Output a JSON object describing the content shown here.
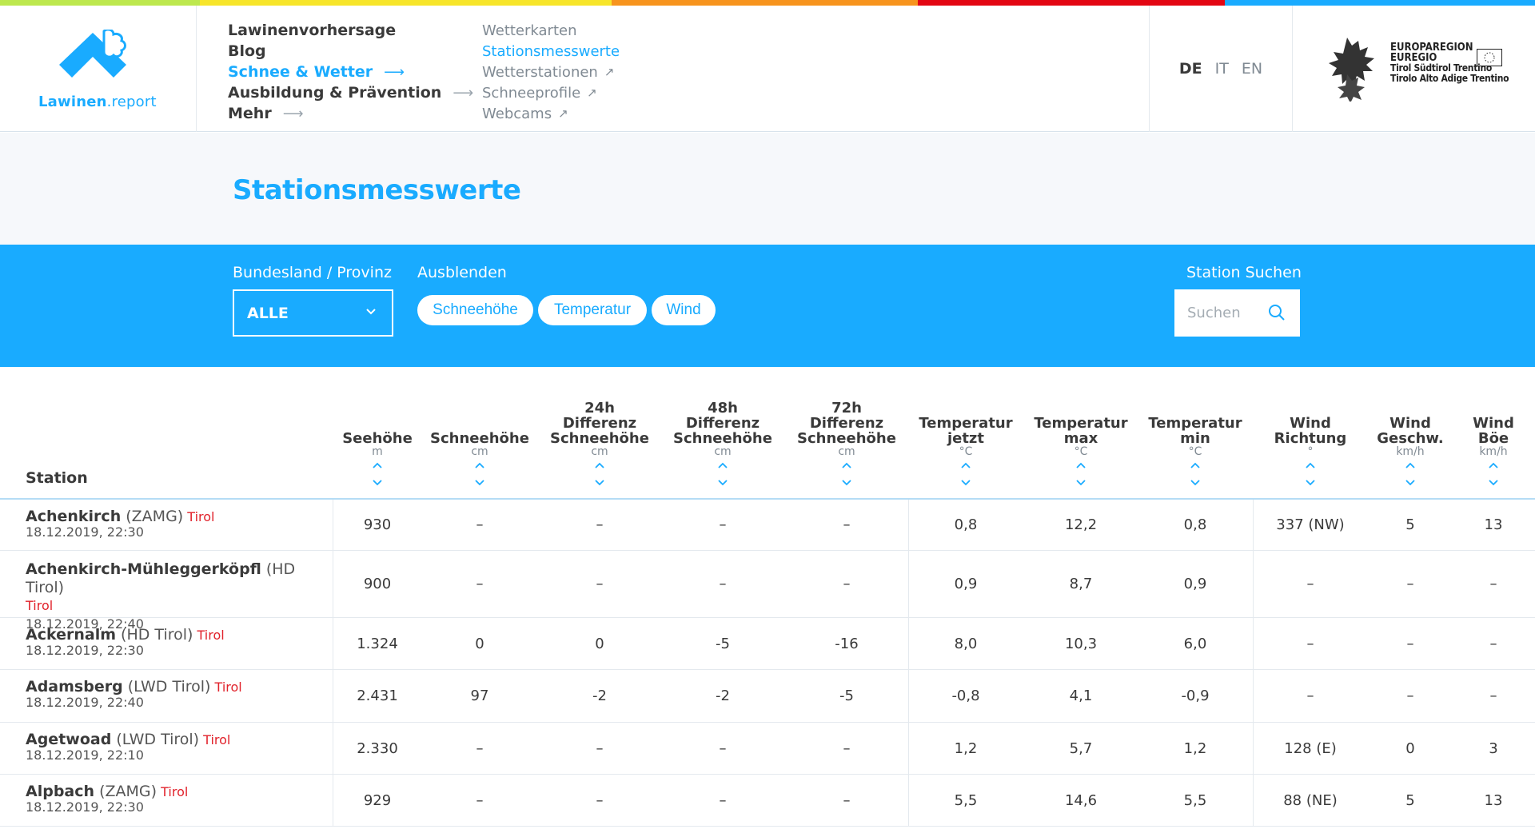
{
  "colors": {
    "accent": "#19abff",
    "region_red": "#e1222b",
    "stripe": [
      "#bde84e",
      "#f7e52a",
      "#f7941d",
      "#e30613",
      "#19abff"
    ]
  },
  "logo": {
    "text_a": "Lawinen",
    "text_b": ".report"
  },
  "nav": {
    "main": [
      {
        "label": "Lawinenvorhersage",
        "arrow": ""
      },
      {
        "label": "Blog",
        "arrow": ""
      },
      {
        "label": "Schnee & Wetter",
        "arrow": "⟶"
      },
      {
        "label": "Ausbildung & Prävention",
        "arrow": "⟶"
      },
      {
        "label": "Mehr",
        "arrow": "⟶"
      }
    ],
    "sub": [
      {
        "label": "Wetterkarten",
        "ext": ""
      },
      {
        "label": "Stationsmesswerte",
        "ext": ""
      },
      {
        "label": "Wetterstationen",
        "ext": "↗"
      },
      {
        "label": "Schneeprofile",
        "ext": "↗"
      },
      {
        "label": "Webcams",
        "ext": "↗"
      }
    ]
  },
  "lang": {
    "de": "DE",
    "it": "IT",
    "en": "EN"
  },
  "euregio": {
    "line1": "EUROPAREGION",
    "line2": "EUREGIO",
    "line3": "Tirol Südtirol Trentino",
    "line4": "Tirolo Alto Adige Trentino"
  },
  "page": {
    "title": "Stationsmesswerte"
  },
  "filters": {
    "region_label": "Bundesland / Provinz",
    "region_value": "ALLE",
    "hide_label": "Ausblenden",
    "hide_buttons": [
      "Schneehöhe",
      "Temperatur",
      "Wind"
    ],
    "search_label": "Station Suchen",
    "search_placeholder": "Suchen"
  },
  "table": {
    "station_header": "Station",
    "columns": [
      {
        "name": [
          "Seehöhe"
        ],
        "unit": "m"
      },
      {
        "name": [
          "Schneehöhe"
        ],
        "unit": "cm"
      },
      {
        "name": [
          "24h",
          "Differenz",
          "Schneehöhe"
        ],
        "unit": "cm"
      },
      {
        "name": [
          "48h",
          "Differenz",
          "Schneehöhe"
        ],
        "unit": "cm"
      },
      {
        "name": [
          "72h",
          "Differenz",
          "Schneehöhe"
        ],
        "unit": "cm"
      },
      {
        "name": [
          "Temperatur",
          "jetzt"
        ],
        "unit": "°C"
      },
      {
        "name": [
          "Temperatur",
          "max"
        ],
        "unit": "°C"
      },
      {
        "name": [
          "Temperatur",
          "min"
        ],
        "unit": "°C"
      },
      {
        "name": [
          "Wind",
          "Richtung"
        ],
        "unit": "°"
      },
      {
        "name": [
          "Wind",
          "Geschw."
        ],
        "unit": "km/h"
      },
      {
        "name": [
          "Wind",
          "Böe"
        ],
        "unit": "km/h"
      }
    ],
    "rows": [
      {
        "name": "Achenkirch",
        "operator": "(ZAMG)",
        "region": "Tirol",
        "date": "18.12.2019, 22:30",
        "values": [
          "930",
          "–",
          "–",
          "–",
          "–",
          "0,8",
          "12,2",
          "0,8",
          "337 (NW)",
          "5",
          "13"
        ]
      },
      {
        "name": "Achenkirch-Mühleggerköpfl",
        "operator": "(HD Tirol)",
        "region": "Tirol",
        "date": "18.12.2019, 22:40",
        "values": [
          "900",
          "–",
          "–",
          "–",
          "–",
          "0,9",
          "8,7",
          "0,9",
          "–",
          "–",
          "–"
        ]
      },
      {
        "name": "Ackernalm",
        "operator": "(HD Tirol)",
        "region": "Tirol",
        "date": "18.12.2019, 22:30",
        "values": [
          "1.324",
          "0",
          "0",
          "-5",
          "-16",
          "8,0",
          "10,3",
          "6,0",
          "–",
          "–",
          "–"
        ]
      },
      {
        "name": "Adamsberg",
        "operator": "(LWD Tirol)",
        "region": "Tirol",
        "date": "18.12.2019, 22:40",
        "values": [
          "2.431",
          "97",
          "-2",
          "-2",
          "-5",
          "-0,8",
          "4,1",
          "-0,9",
          "–",
          "–",
          "–"
        ]
      },
      {
        "name": "Agetwoad",
        "operator": "(LWD Tirol)",
        "region": "Tirol",
        "date": "18.12.2019, 22:10",
        "values": [
          "2.330",
          "–",
          "–",
          "–",
          "–",
          "1,2",
          "5,7",
          "1,2",
          "128 (E)",
          "0",
          "3"
        ]
      },
      {
        "name": "Alpbach",
        "operator": "(ZAMG)",
        "region": "Tirol",
        "date": "18.12.2019, 22:30",
        "values": [
          "929",
          "–",
          "–",
          "–",
          "–",
          "5,5",
          "14,6",
          "5,5",
          "88 (NE)",
          "5",
          "13"
        ]
      }
    ]
  }
}
